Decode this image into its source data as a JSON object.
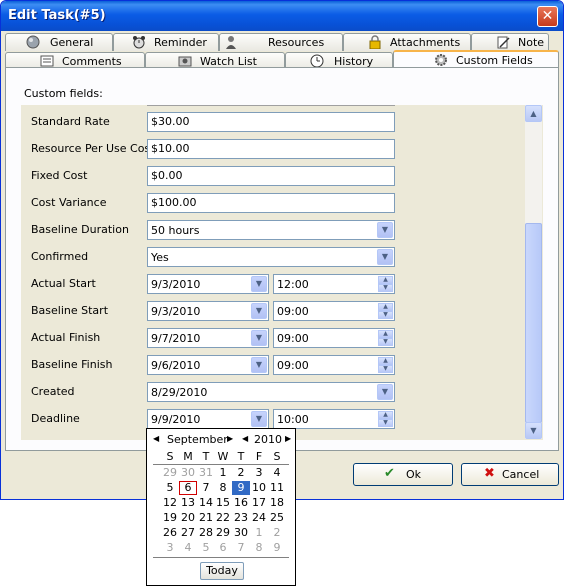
{
  "window": {
    "title": "Edit Task(#5)",
    "close_symbol": "✕"
  },
  "tabs_row1": [
    {
      "label": "General",
      "icon": "globe-icon"
    },
    {
      "label": "Reminder",
      "icon": "alarm-clock-icon"
    },
    {
      "label": "Resources",
      "icon": "person-icon"
    },
    {
      "label": "Attachments",
      "icon": "lock-icon"
    },
    {
      "label": "Note",
      "icon": "note-icon"
    }
  ],
  "tabs_row2": [
    {
      "label": "Comments",
      "icon": "comments-icon"
    },
    {
      "label": "Watch List",
      "icon": "watch-list-icon"
    },
    {
      "label": "History",
      "icon": "clock-icon"
    },
    {
      "label": "Custom Fields",
      "icon": "gear-icon",
      "active": true
    }
  ],
  "panel": {
    "heading": "Custom fields:"
  },
  "fields": {
    "standard_rate": {
      "label": "Standard Rate",
      "value": "$30.00"
    },
    "resource_per_use_cost": {
      "label": "Resource Per Use Cost",
      "value": "$10.00"
    },
    "fixed_cost": {
      "label": "Fixed Cost",
      "value": "$0.00"
    },
    "cost_variance": {
      "label": "Cost Variance",
      "value": "$100.00"
    },
    "baseline_duration": {
      "label": "Baseline Duration",
      "value": "50 hours"
    },
    "confirmed": {
      "label": "Confirmed",
      "value": "Yes"
    },
    "actual_start": {
      "label": "Actual Start",
      "date": "9/3/2010",
      "time": "12:00"
    },
    "baseline_start": {
      "label": "Baseline Start",
      "date": "9/3/2010",
      "time": "09:00"
    },
    "actual_finish": {
      "label": "Actual Finish",
      "date": "9/7/2010",
      "time": "09:00"
    },
    "baseline_finish": {
      "label": "Baseline Finish",
      "date": "9/6/2010",
      "time": "09:00"
    },
    "created": {
      "label": "Created",
      "value": "8/29/2010"
    },
    "deadline": {
      "label": "Deadline",
      "date": "9/9/2010",
      "time": "10:00"
    }
  },
  "buttons": {
    "ok": {
      "label": "Ok",
      "icon": "checkmark-icon"
    },
    "cancel": {
      "label": "Cancel",
      "icon": "x-icon"
    }
  },
  "calendar": {
    "month": "September",
    "year": "2010",
    "weekdays": [
      "S",
      "M",
      "T",
      "W",
      "T",
      "F",
      "S"
    ],
    "weeks": [
      [
        "29",
        "30",
        "31",
        "1",
        "2",
        "3",
        "4"
      ],
      [
        "5",
        "6",
        "7",
        "8",
        "9",
        "10",
        "11"
      ],
      [
        "12",
        "13",
        "14",
        "15",
        "16",
        "17",
        "18"
      ],
      [
        "19",
        "20",
        "21",
        "22",
        "23",
        "24",
        "25"
      ],
      [
        "26",
        "27",
        "28",
        "29",
        "30",
        "1",
        "2"
      ],
      [
        "3",
        "4",
        "5",
        "6",
        "7",
        "8",
        "9"
      ]
    ],
    "today_label": "Today"
  }
}
